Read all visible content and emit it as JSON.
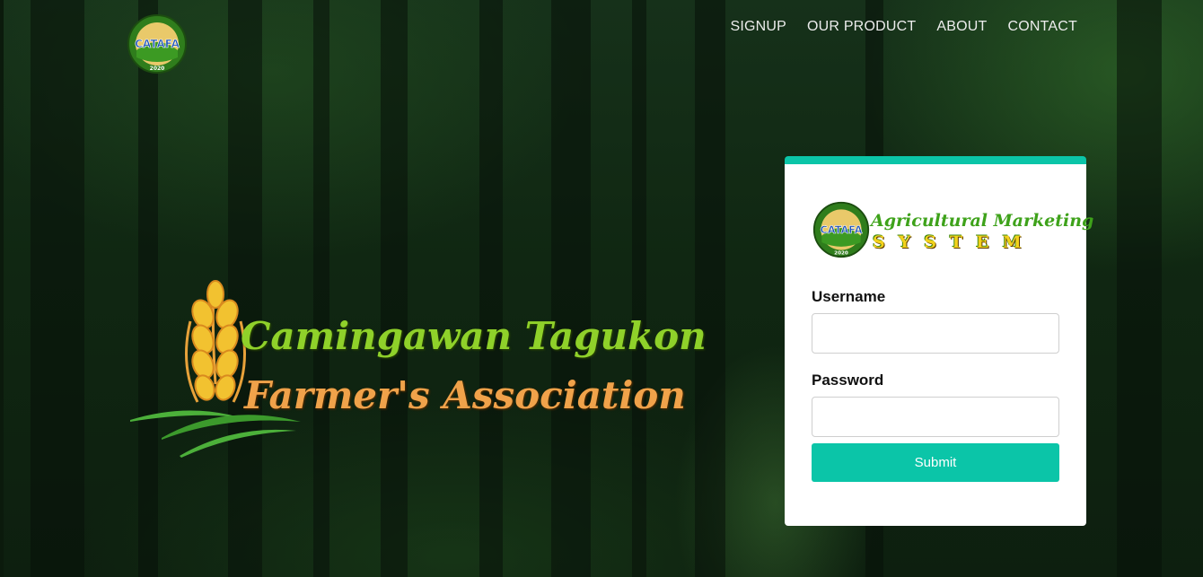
{
  "nav": {
    "items": [
      {
        "label": "SIGNUP"
      },
      {
        "label": "OUR PRODUCT"
      },
      {
        "label": "ABOUT"
      },
      {
        "label": "CONTACT"
      }
    ]
  },
  "header_logo": {
    "text": "CATAFA",
    "year": "2020"
  },
  "brand": {
    "line1": "Camingawan Tagukon",
    "line2": "Farmer's Association"
  },
  "login": {
    "logo_text_top": "Agricultural Marketing",
    "logo_text_bottom": "SYSTEM",
    "logo_badge_text": "CATAFA",
    "logo_badge_year": "2020",
    "username_label": "Username",
    "password_label": "Password",
    "username_value": "",
    "password_value": "",
    "submit_label": "Submit"
  },
  "colors": {
    "accent": "#0bc5a8",
    "brand_green": "#8fd12a",
    "brand_orange": "#f0a24a",
    "wheat_gold": "#f2c230"
  }
}
